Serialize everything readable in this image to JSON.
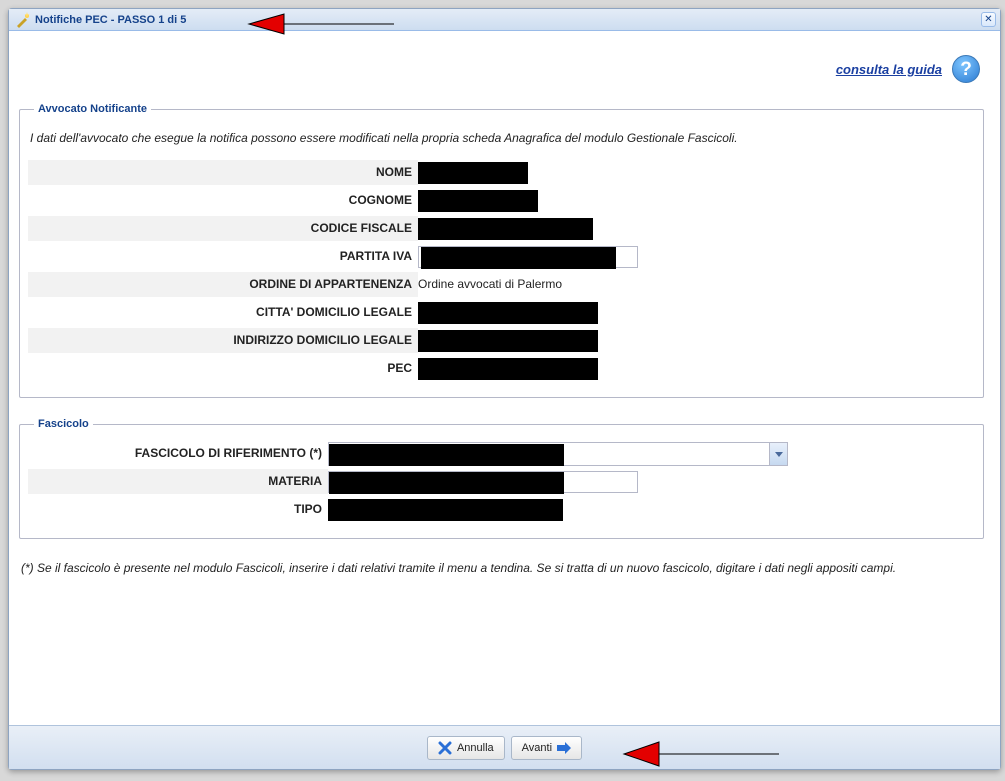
{
  "window": {
    "title": "Notifiche PEC - PASSO 1 di 5"
  },
  "topbar": {
    "help_link": "consulta la guida"
  },
  "avvocato": {
    "legend": "Avvocato Notificante",
    "note": "I dati dell'avvocato che esegue la notifica possono essere modificati nella propria scheda Anagrafica del modulo Gestionale Fascicoli.",
    "labels": {
      "nome": "NOME",
      "cognome": "COGNOME",
      "cf": "CODICE FISCALE",
      "piva": "PARTITA IVA",
      "ordine": "ORDINE DI APPARTENENZA",
      "citta": "CITTA' DOMICILIO LEGALE",
      "indirizzo": "INDIRIZZO DOMICILIO LEGALE",
      "pec": "PEC"
    },
    "values": {
      "ordine": "Ordine avvocati di Palermo"
    }
  },
  "fascicolo": {
    "legend": "Fascicolo",
    "labels": {
      "riferimento": "FASCICOLO DI RIFERIMENTO (*)",
      "materia": "MATERIA",
      "tipo": "TIPO"
    }
  },
  "footnote": "(*) Se il fascicolo è presente nel modulo Fascicoli, inserire i dati relativi tramite il menu a tendina. Se si tratta di un nuovo fascicolo, digitare i dati negli appositi campi.",
  "footer": {
    "cancel": "Annulla",
    "next": "Avanti"
  }
}
